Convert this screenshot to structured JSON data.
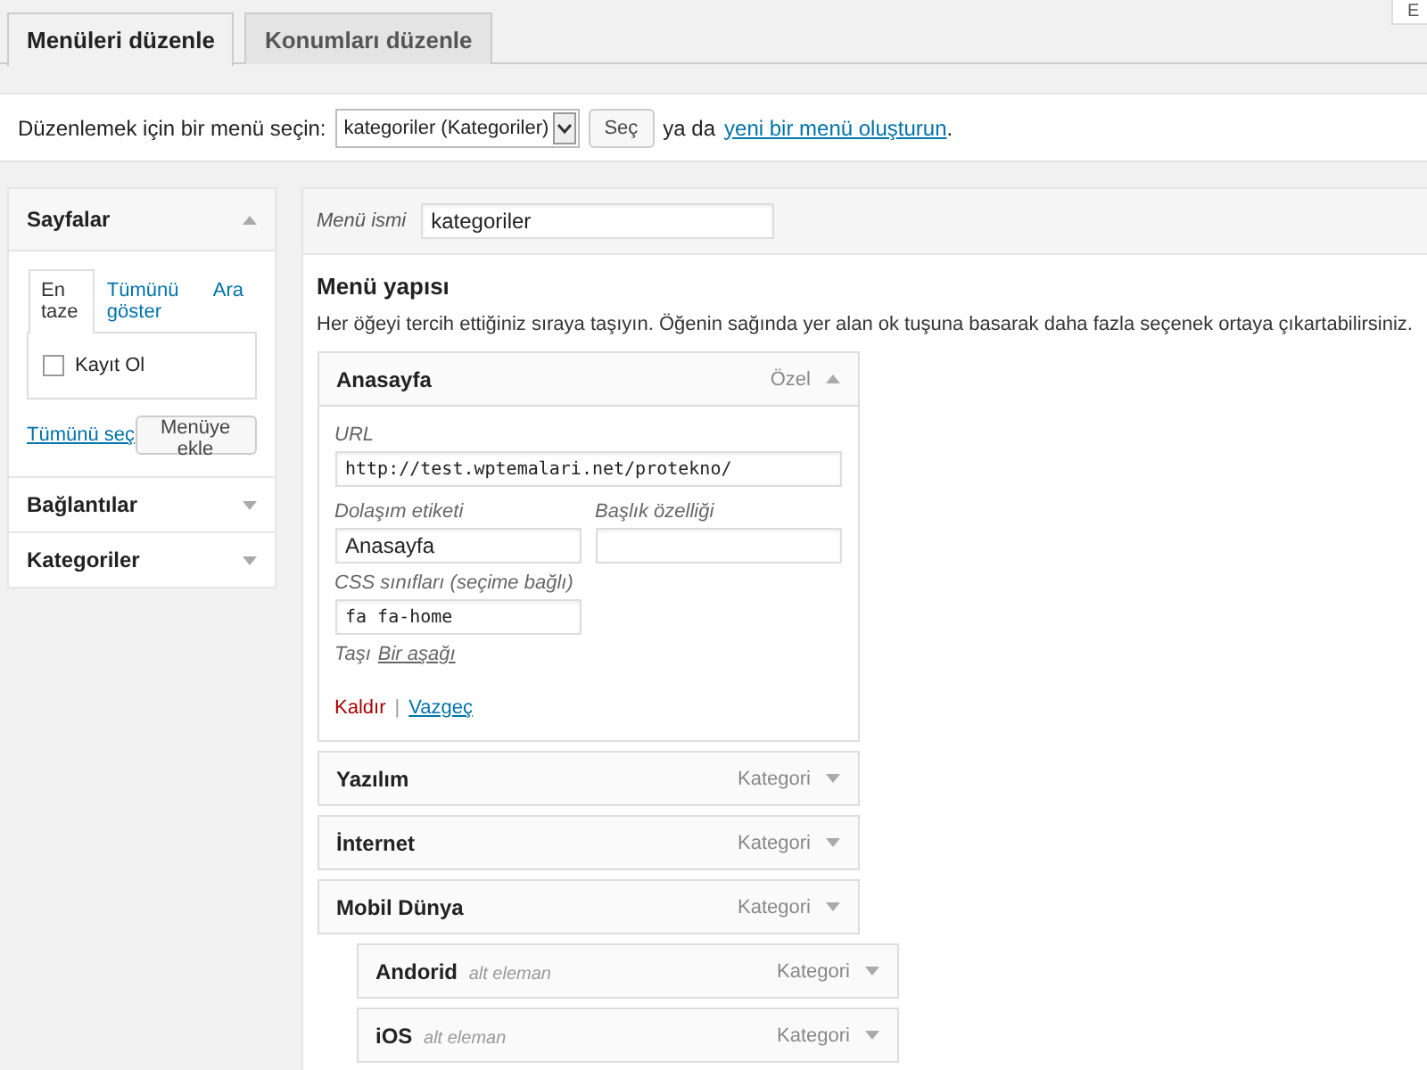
{
  "corner_button": "E",
  "tabs": [
    {
      "label": "Menüleri düzenle",
      "selected": true
    },
    {
      "label": "Konumları düzenle",
      "selected": false
    }
  ],
  "menu_select": {
    "label": "Düzenlemek için bir menü seçin:",
    "value": "kategoriler (Kategoriler)",
    "button": "Seç",
    "or_text": "ya da",
    "create_link": "yeni bir menü oluşturun",
    "end": "."
  },
  "sidebar": {
    "panels": [
      {
        "title": "Sayfalar",
        "expanded": true,
        "tabs": [
          {
            "label": "En taze",
            "selected": true
          },
          {
            "label": "Tümünü göster",
            "selected": false
          },
          {
            "label": "Ara",
            "selected": false
          }
        ],
        "items": [
          {
            "label": "Kayıt Ol",
            "checked": false
          }
        ],
        "select_all": "Tümünü seç",
        "add_button": "Menüye ekle"
      },
      {
        "title": "Bağlantılar",
        "expanded": false
      },
      {
        "title": "Kategoriler",
        "expanded": false
      }
    ]
  },
  "editor": {
    "name_label": "Menü ismi",
    "name_value": "kategoriler",
    "heading": "Menü yapısı",
    "description": "Her öğeyi tercih ettiğiniz sıraya taşıyın. Öğenin sağında yer alan ok tuşuna basarak daha fazla seçenek ortaya çıkartabilirsiniz.",
    "items": [
      {
        "title": "Anasayfa",
        "type": "Özel",
        "expanded": true,
        "fields": {
          "url_label": "URL",
          "url": "http://test.wptemalari.net/protekno/",
          "nav_label": "Dolaşım etiketi",
          "nav_value": "Anasayfa",
          "title_attr_label": "Başlık özelliği",
          "css_label": "CSS sınıfları (seçime bağlı)",
          "css_value": "fa fa-home",
          "move_label": "Taşı",
          "move_link": "Bir aşağı",
          "remove": "Kaldır",
          "separator": "|",
          "cancel": "Vazgeç"
        }
      },
      {
        "title": "Yazılım",
        "type": "Kategori",
        "expanded": false
      },
      {
        "title": "İnternet",
        "type": "Kategori",
        "expanded": false
      },
      {
        "title": "Mobil Dünya",
        "type": "Kategori",
        "expanded": false,
        "children": [
          {
            "title": "Andorid",
            "note": "alt eleman",
            "type": "Kategori",
            "expanded": false
          },
          {
            "title": "iOS",
            "note": "alt eleman",
            "type": "Kategori",
            "expanded": false
          }
        ]
      }
    ]
  }
}
